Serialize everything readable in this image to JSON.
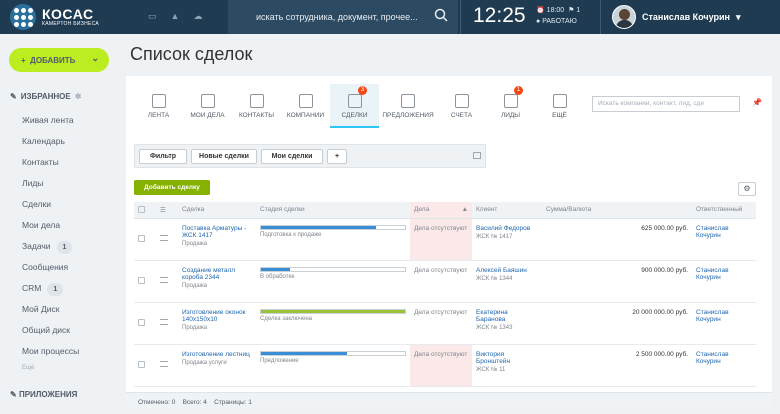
{
  "topbar": {
    "logo_title": "КОСАС",
    "logo_subtitle": "КАМЕРТОН БИЗНЕСА",
    "search_placeholder": "искать сотрудника, документ, прочее...",
    "time": "12:25",
    "alarm_time": "18:00",
    "alarm_count": "1",
    "work_status": "РАБОТАЮ",
    "user_name": "Станислав Кочурин"
  },
  "sidebar": {
    "add_button": "ДОБАВИТЬ",
    "favorites_title": "ИЗБРАННОЕ",
    "items": [
      {
        "label": "Живая лента",
        "count": ""
      },
      {
        "label": "Календарь",
        "count": ""
      },
      {
        "label": "Контакты",
        "count": ""
      },
      {
        "label": "Лиды",
        "count": ""
      },
      {
        "label": "Сделки",
        "count": ""
      },
      {
        "label": "Мои дела",
        "count": ""
      },
      {
        "label": "Задачи",
        "count": "1"
      },
      {
        "label": "Сообщения",
        "count": ""
      },
      {
        "label": "CRM",
        "count": "1"
      },
      {
        "label": "Мой Диск",
        "count": ""
      },
      {
        "label": "Общий диск",
        "count": ""
      },
      {
        "label": "Мои процессы",
        "count": ""
      }
    ],
    "more_label": "Ещё",
    "apps_title": "ПРИЛОЖЕНИЯ"
  },
  "page": {
    "title": "Список сделок"
  },
  "tabs": [
    {
      "label": "ЛЕНТА",
      "badge": "",
      "icon": "feed-icon"
    },
    {
      "label": "МОИ ДЕЛА",
      "badge": "",
      "icon": "tasks-icon"
    },
    {
      "label": "КОНТАКТЫ",
      "badge": "",
      "icon": "contacts-icon"
    },
    {
      "label": "КОМПАНИИ",
      "badge": "",
      "icon": "companies-icon"
    },
    {
      "label": "СДЕЛКИ",
      "badge": "3",
      "icon": "handshake-icon"
    },
    {
      "label": "ПРЕДЛОЖЕНИЯ",
      "badge": "",
      "icon": "offers-icon"
    },
    {
      "label": "СЧЕТА",
      "badge": "",
      "icon": "invoice-icon"
    },
    {
      "label": "ЛИДЫ",
      "badge": "1",
      "icon": "leads-icon"
    },
    {
      "label": "ЕЩЁ",
      "badge": "",
      "icon": "list-icon"
    }
  ],
  "tab_search_placeholder": "Искать компании, контакт, лид, сде",
  "filters": {
    "filter": "Фильтр",
    "new_deals": "Новые сделки",
    "my_deals": "Мои сделки",
    "add": "+"
  },
  "add_deal": "Добавить сделку",
  "table": {
    "headers": {
      "deal": "Сделка",
      "stage": "Стадия сделки",
      "activity": "Дела",
      "client": "Клиент",
      "amount": "Сумма/Валюта",
      "responsible": "Ответственный"
    },
    "rows": [
      {
        "deal": "Поставка Арматуры - ЖСК 1417",
        "type": "Продажа",
        "stage": "Подготовка к продаже",
        "progress": 0.8,
        "bar_color": "#3a8ed6",
        "activity": "Дела отсутствуют",
        "client": "Василий Федоров",
        "client_sub": "ЖСК № 1417",
        "amount": "625 000.00 руб.",
        "responsible": "Станислав Кочурин"
      },
      {
        "deal": "Создание металл короба 2344",
        "type": "Продажа",
        "stage": "В обработке",
        "progress": 0.2,
        "bar_color": "#3a8ed6",
        "activity": "Дела отсутствуют",
        "client": "Алексей Баяшин",
        "client_sub": "ЖСК № 1344",
        "amount": "900 000.00 руб.",
        "responsible": "Станислав Кочурин"
      },
      {
        "deal": "Изготовление оконок 140х150х10",
        "type": "Продажа",
        "stage": "Сделка заключена",
        "progress": 1.0,
        "bar_color": "#9ac23a",
        "activity": "Дела отсутствуют",
        "client": "Екатерина Баранова",
        "client_sub": "ЖСК № 1343",
        "amount": "20 000 000.00 руб.",
        "responsible": "Станислав Кочурин"
      },
      {
        "deal": "Изготовление лестниц",
        "type": "Продажа услуги",
        "stage": "Предложение",
        "progress": 0.6,
        "bar_color": "#3a8ed6",
        "activity": "Дела отсутствуют",
        "client": "Виктория Бронштейн",
        "client_sub": "ЖСК № 11",
        "amount": "2 500 000.00 руб.",
        "responsible": "Станислав Кочурин"
      }
    ]
  },
  "footer": {
    "selected_label": "Отмечено:",
    "selected": "0",
    "total_label": "Всего:",
    "total": "4",
    "pages_label": "Страницы:",
    "pages": "1"
  }
}
